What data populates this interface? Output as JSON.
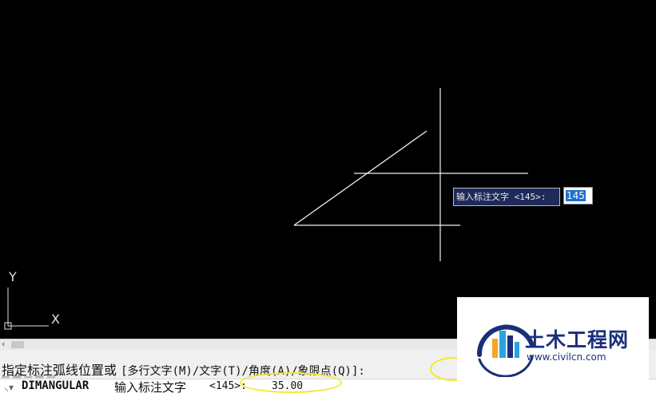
{
  "viewport": {
    "ucs_x_label": "X",
    "ucs_y_label": "Y",
    "tooltip_prompt": "输入标注文字 <145>:",
    "input_value": "145"
  },
  "command_line": {
    "history_prompt": "指定标注弧线位置或",
    "history_options": "[多行文字(M)/文字(T)/角度(A)/象限点(Q)]:",
    "command_name": "DIMANGULAR",
    "current_prompt": "输入标注文字",
    "default_value": "<145>:",
    "typed_value": "35.00"
  },
  "watermark": {
    "name": "土木工程网",
    "url": "www.civilcn.com"
  },
  "colors": {
    "canvas_bg": "#000000",
    "highlight": "#f5e82a",
    "tooltip_bg": "#1e2a5a",
    "logo_blue": "#1a2f7a"
  }
}
